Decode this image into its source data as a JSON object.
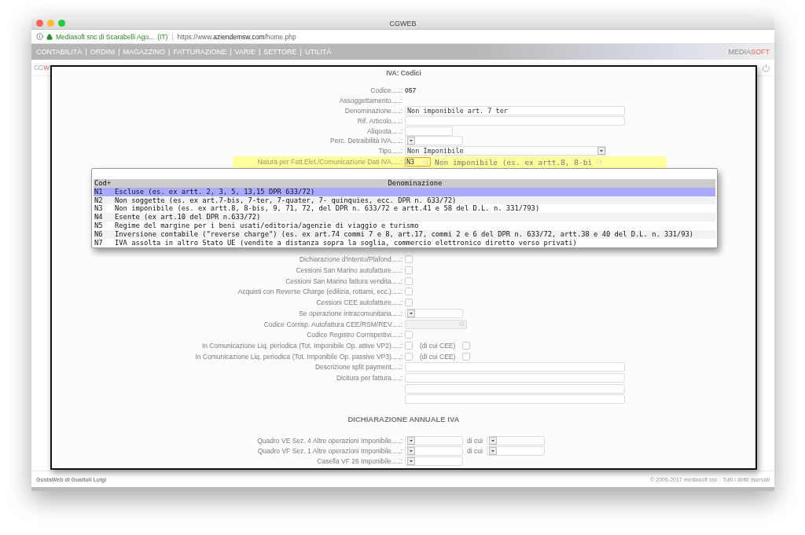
{
  "window": {
    "title": "CGWEB"
  },
  "address_bar": {
    "site_identity": "Mediasoft snc di Scarabelli Ago...",
    "country": "(IT)",
    "url": "https://www.**aziendemsw.com**/home.php"
  },
  "nav": {
    "separator": "|",
    "items": [
      "CONTABILITÀ",
      "ORDINI",
      "MAGAZZINO",
      "FATTURAZIONE",
      "VARIE",
      "SETTORE",
      "UTILITÀ"
    ],
    "logo": {
      "part1": "MEDIA",
      "part2": "SOFT"
    }
  },
  "subheader": {
    "brand_part1": "CG",
    "brand_part2": "W"
  },
  "dialog": {
    "title": "IVA: Codici",
    "top_rows": [
      {
        "kind": "static",
        "label": "Codice.....:",
        "value": "057"
      },
      {
        "kind": "empty",
        "label": "Assoggettamento.....:"
      },
      {
        "kind": "wide_input",
        "label": "Denominazione.....:",
        "value": "Non imponibile art. 7 ter"
      },
      {
        "kind": "wide_input",
        "label": "Rif. Articolo.....:"
      },
      {
        "kind": "small_input",
        "label": "Aliquota.....:"
      },
      {
        "kind": "small_select",
        "label": "Perc. Detraibilità IVA.....:"
      },
      {
        "kind": "wide_select",
        "label": "Tipo.....:",
        "value": "Non Imponibile"
      }
    ],
    "natura": {
      "label": "Natura per Fatt.Elet./Comunicazione Dati IVA.....:",
      "code": "N3",
      "description": "Non imponibile (es. ex artt.8, 8-bi"
    },
    "rows": [
      {
        "kind": "checkbox",
        "label": "Dichiarazione d'intento/Plafond.....:",
        "checked": false
      },
      {
        "kind": "checkbox",
        "label": "Cessioni San Marino autofatture.....:",
        "checked": false
      },
      {
        "kind": "checkbox",
        "label": "Cessioni San Marino fattura vendita.....:",
        "checked": false
      },
      {
        "kind": "checkbox",
        "label": "Acquisti con Reverse Charge (edilizia, rottami, ecc.).....:",
        "checked": false
      },
      {
        "kind": "checkbox",
        "label": "Cessioni CEE autofatture.....:",
        "checked": false
      },
      {
        "kind": "small_select",
        "label": "Se operazione intracomunitaria.....:"
      },
      {
        "kind": "lookup",
        "label": "Codice Corrisp. Autofattura CEE/RSM/REV.....:",
        "disabled": true
      },
      {
        "kind": "checkbox",
        "label": "Codice Registro Corrispettivi.....:",
        "checked": false
      },
      {
        "kind": "checkbox",
        "label": "In Comunicazione Liq. periodica (Tot. Imponibile Op. attive VP2).....:",
        "checked": false,
        "extra_label": "(di cui CEE)",
        "extra_checked": false
      },
      {
        "kind": "checkbox",
        "label": "In Comunicazione Liq. periodica (Tot. Imponibile Op. passive VP3).....:",
        "checked": false,
        "extra_label": "(di cui CEE)",
        "extra_checked": false
      },
      {
        "kind": "wide_input",
        "label": "Descrizione split payment.....:"
      },
      {
        "kind": "wide_input",
        "label": "Dicitura per fattura.....:"
      },
      {
        "kind": "wide_input"
      },
      {
        "kind": "wide_input"
      }
    ],
    "annual": {
      "title": "DICHIARAZIONE ANNUALE IVA",
      "rows": [
        {
          "kind": "select_pair",
          "label": "Quadro VE Sez. 4 Altre operazioni Imponibile.....:",
          "extra_label": "di cui"
        },
        {
          "kind": "select_pair",
          "label": "Quadro VF Sez. 1 Altre operazioni Imponibile.....:",
          "extra_label": "di cui"
        },
        {
          "kind": "small_select",
          "label": "Casella VF 26 Imponibile.....:"
        }
      ]
    },
    "lookup_popup": {
      "columns": [
        "Cod+",
        "Denominazione"
      ],
      "rows": [
        {
          "code": "N1",
          "name": "Escluse (es. ex artt. 2, 3, 5, 13,15 DPR 633/72)",
          "selected": true
        },
        {
          "code": "N2",
          "name": "Non soggette (es. ex art.7-bis, 7-ter, 7-quater, 7- quinquies, ecc. DPR n. 633/72)",
          "selected": false
        },
        {
          "code": "N3",
          "name": "Non imponibile (es. ex artt.8, 8-bis, 9, 71, 72, del DPR n. 633/72 e artt.41 e 58 del D.L. n. 331/793)",
          "selected": false
        },
        {
          "code": "N4",
          "name": "Esente (ex art.10 del DPR n.633/72)",
          "selected": false
        },
        {
          "code": "N5",
          "name": "Regime del margine per i beni usati/editoria/agenzie di viaggio e turismo",
          "selected": false
        },
        {
          "code": "N6",
          "name": "Inversione contabile (\"reverse charge\") (es. ex art.74 commi 7 e 8, art.17, commi 2 e 6 del DPR n. 633/72, artt.38 e 40 del D.L. n. 331/93)",
          "selected": false
        },
        {
          "code": "N7",
          "name": "IVA assolta in altro Stato UE (vendite a distanza sopra la soglia, commercio elettronico diretto verso privati)",
          "selected": false
        }
      ]
    }
  },
  "footer": {
    "left": "GustaWeb di Guaitoli Luigi",
    "right": "© 2005-2017 mediasoft snc - Tutti i diritti riservati"
  }
}
